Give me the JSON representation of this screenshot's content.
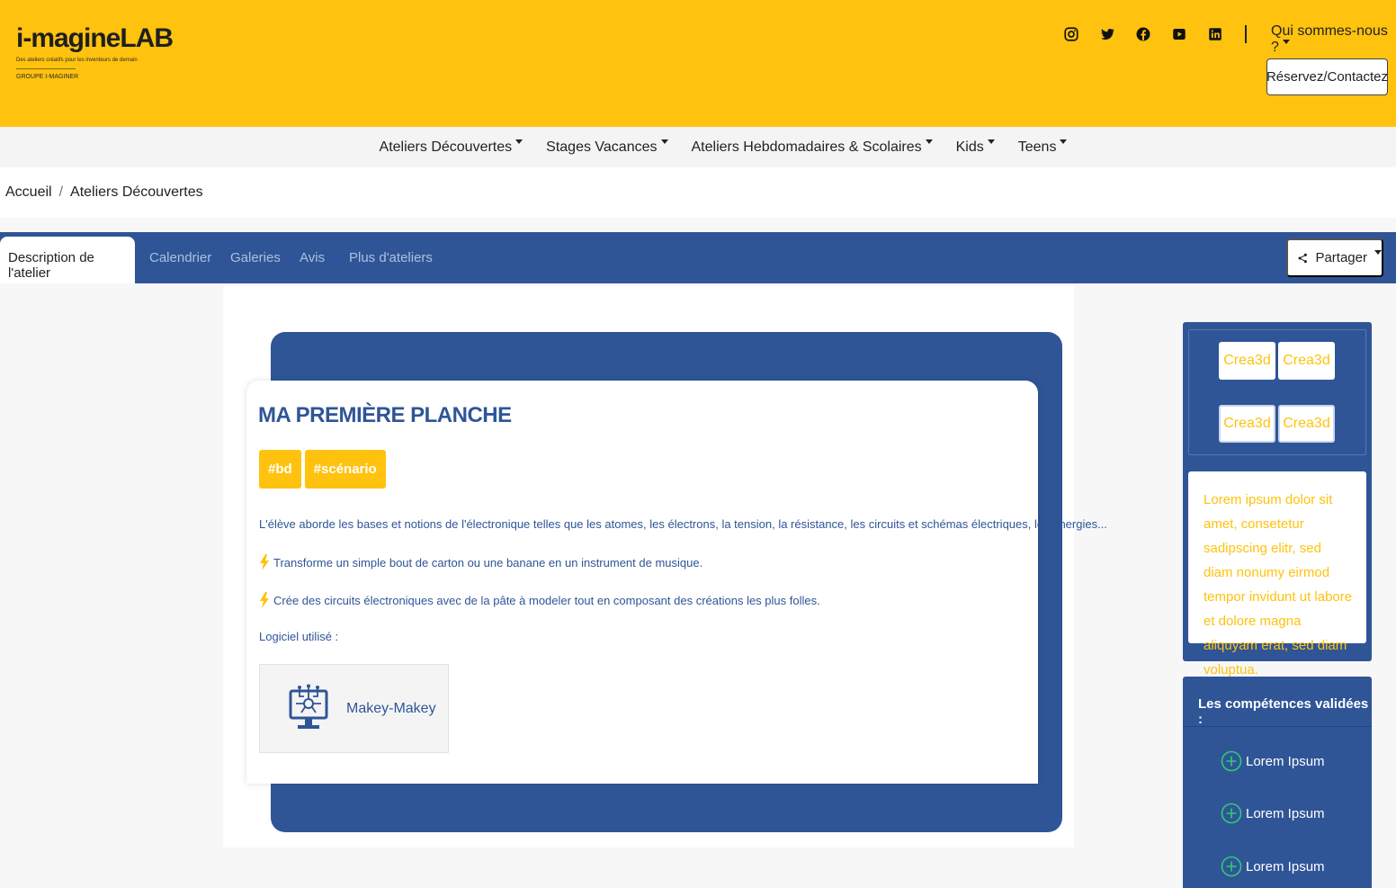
{
  "brand": {
    "logo_text": "i-magineLAB",
    "tagline": "Des ateliers créatifs pour les inventeurs de demain",
    "group": "GROUPE I-MAGINER"
  },
  "header": {
    "social_icons": [
      "instagram-icon",
      "twitter-icon",
      "facebook-icon",
      "youtube-icon",
      "linkedin-icon"
    ],
    "about_menu": "Qui sommes-nous ?",
    "contact_button": "Réservez/Contactez"
  },
  "nav": {
    "items": [
      "Ateliers Découvertes",
      "Stages Vacances",
      "Ateliers Hebdomadaires & Scolaires",
      "Kids",
      "Teens"
    ]
  },
  "breadcrumb": {
    "home": "Accueil",
    "separator": "/",
    "current": "Ateliers Découvertes"
  },
  "tabs": {
    "items": [
      "Description de l'atelier",
      "Calendrier",
      "Galeries",
      "Avis",
      "Plus d'ateliers"
    ],
    "share": "Partager"
  },
  "workshop": {
    "title": "MA PREMIÈRE PLANCHE",
    "tags": [
      "#bd",
      "#scénario"
    ],
    "description": "L'élève aborde les bases et notions de l'électronique telles que les atomes, les électrons, la tension, la résistance, les circuits et schémas électriques, les énergies...",
    "bullets": [
      "Transforme un simple bout de carton ou une banane en un instrument de musique.",
      "Crée des circuits électroniques avec de la pâte à modeler tout en composant des créations les plus folles."
    ],
    "software_label": "Logiciel utilisé :",
    "software_name": "Makey-Makey"
  },
  "sidebar": {
    "partners": [
      "Crea3d",
      "Crea3d",
      "Crea3d",
      "Crea3d"
    ],
    "lorem": "Lorem ipsum dolor sit amet, consetetur sadipscing elitr, sed diam nonumy eirmod tempor invidunt ut labore et dolore magna aliquyam erat, sed diam voluptua.",
    "skills_title": "Les compétences validées :",
    "skills": [
      "Lorem Ipsum",
      "Lorem Ipsum",
      "Lorem Ipsum"
    ]
  },
  "colors": {
    "brand_yellow": "#ffc20e",
    "brand_blue": "#2f5597",
    "skill_green": "#2ecc71"
  }
}
